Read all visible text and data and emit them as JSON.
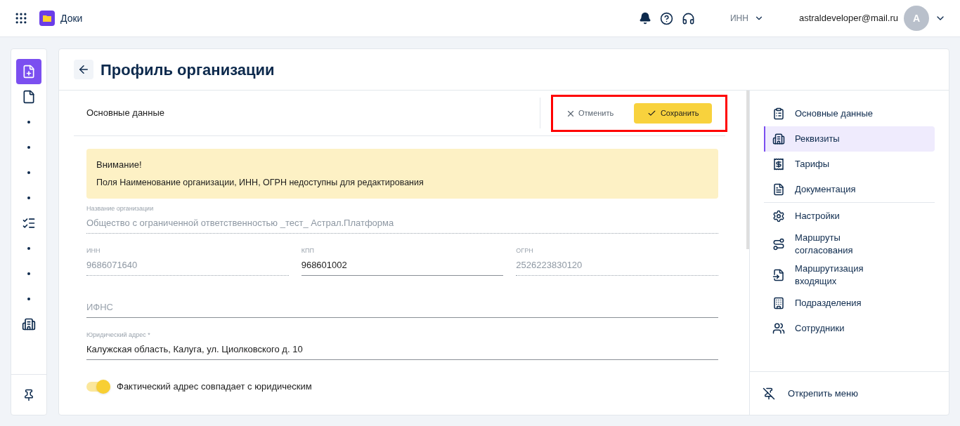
{
  "header": {
    "app_name": "Доки",
    "inn_selector": "ИНН",
    "user_email": "astraldeveloper@mail.ru",
    "avatar": "А"
  },
  "rail": {
    "items": [
      {
        "kind": "new-document",
        "selected": true
      },
      {
        "kind": "document",
        "selected": false
      },
      {
        "kind": "dot",
        "selected": false
      },
      {
        "kind": "dot",
        "selected": false
      },
      {
        "kind": "dot",
        "selected": false
      },
      {
        "kind": "dot",
        "selected": false
      },
      {
        "kind": "sliders",
        "selected": false
      },
      {
        "kind": "dot",
        "selected": false
      },
      {
        "kind": "dot",
        "selected": false
      },
      {
        "kind": "dot",
        "selected": false
      },
      {
        "kind": "building",
        "selected": false
      }
    ]
  },
  "page": {
    "title": "Профиль организации"
  },
  "form": {
    "section_tab": "Основные данные",
    "cancel_button": "Отменить",
    "save_button": "Сохранить",
    "alert": {
      "title": "Внимание!",
      "text": "Поля Наименование организации, ИНН, ОГРН недоступны для редактирования"
    },
    "rows": [
      [
        {
          "label": "Название организации",
          "value": "Общество с ограниченной ответственностью _тест_ Астрал.Платформа",
          "disabled": true
        }
      ],
      [
        {
          "label": "ИНН",
          "value": "9686071640",
          "disabled": true
        },
        {
          "label": "КПП",
          "value": "968601002",
          "disabled": false
        },
        {
          "label": "ОГРН",
          "value": "2526223830120",
          "disabled": true
        }
      ],
      [
        {
          "placeholder": "ИФНС",
          "disabled": false
        }
      ],
      [
        {
          "label": "Юридический адрес *",
          "value": "Калужская область, Калуга, ул. Циолковского д. 10",
          "disabled": false
        }
      ]
    ],
    "toggle": {
      "label": "Фактический адрес совпадает с юридическим",
      "on": true
    }
  },
  "side_nav": {
    "groups": [
      [
        {
          "label": "Основные данные",
          "selected": false
        },
        {
          "label": "Реквизиты",
          "selected": true
        },
        {
          "label": "Тарифы",
          "selected": false
        },
        {
          "label": "Документация",
          "selected": false
        }
      ],
      [
        {
          "label": "Настройки",
          "selected": false
        },
        {
          "label": "Маршруты согласования",
          "selected": false
        },
        {
          "label": "Маршрутизация входящих",
          "selected": false
        },
        {
          "label": "Подразделения",
          "selected": false
        },
        {
          "label": "Сотрудники",
          "selected": false
        }
      ]
    ],
    "unpin": "Открепить меню"
  }
}
